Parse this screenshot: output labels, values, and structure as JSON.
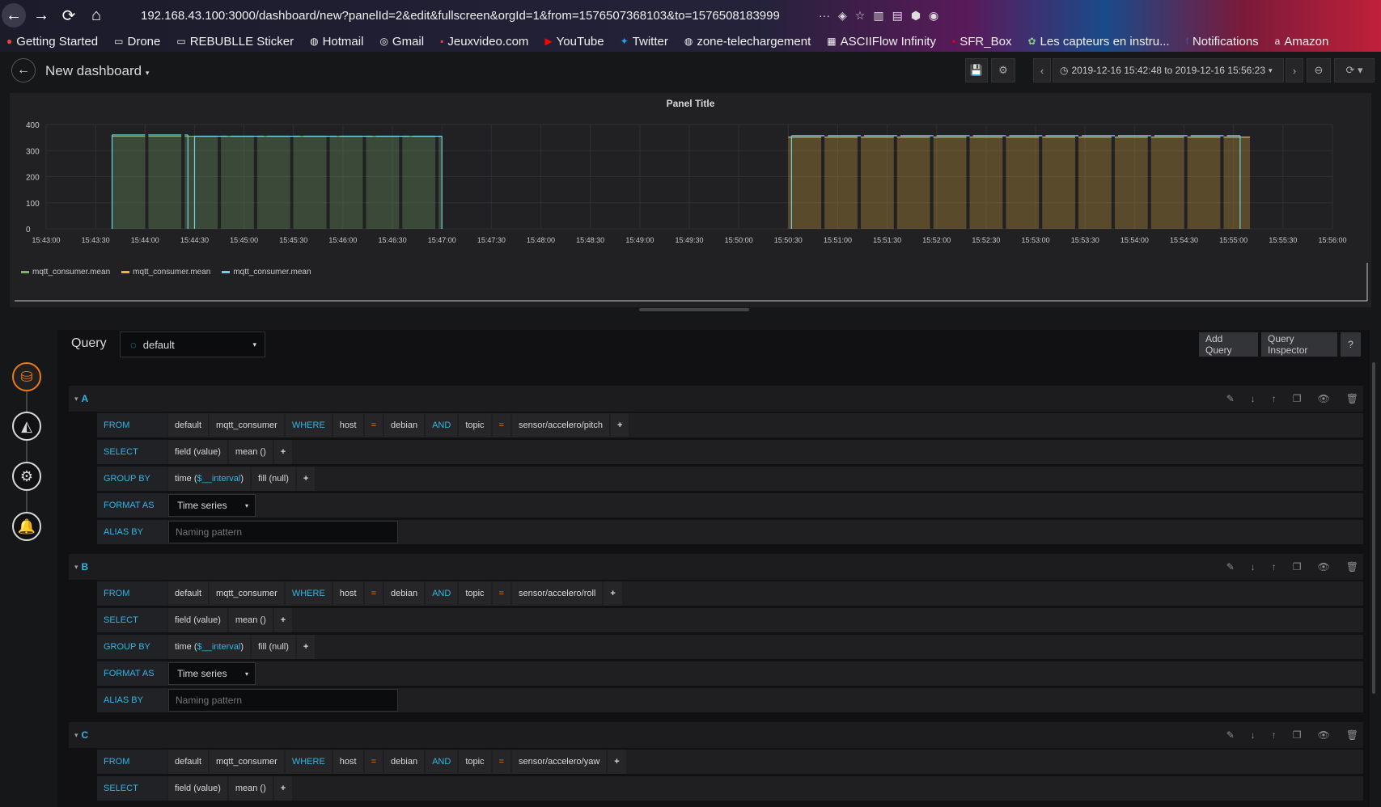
{
  "browser": {
    "url": "192.168.43.100:3000/dashboard/new?panelId=2&edit&fullscreen&orgId=1&from=1576507368103&to=1576508183999",
    "bookmarks": [
      "Getting Started",
      "Drone",
      "REBUBLLE Sticker",
      "Hotmail",
      "Gmail",
      "Jeuxvideo.com",
      "YouTube",
      "Twitter",
      "zone-telechargement",
      "ASCIIFlow Infinity",
      "SFR_Box",
      "Les capteurs en instru...",
      "Notifications",
      "Amazon"
    ]
  },
  "header": {
    "title": "New dashboard",
    "time_range": "2019-12-16 15:42:48 to 2019-12-16 15:56:23"
  },
  "panel": {
    "title": "Panel Title",
    "legend": [
      {
        "name": "mqtt_consumer.mean",
        "color": "#7eb26d"
      },
      {
        "name": "mqtt_consumer.mean",
        "color": "#eab839"
      },
      {
        "name": "mqtt_consumer.mean",
        "color": "#6ed0e0"
      }
    ]
  },
  "chart_data": {
    "type": "bar",
    "y_ticks": [
      "400",
      "300",
      "200",
      "100",
      "0"
    ],
    "ylim": [
      0,
      400
    ],
    "x_ticks": [
      "15:43:00",
      "15:43:30",
      "15:44:00",
      "15:44:30",
      "15:45:00",
      "15:45:30",
      "15:46:00",
      "15:46:30",
      "15:47:00",
      "15:47:30",
      "15:48:00",
      "15:48:30",
      "15:49:00",
      "15:49:30",
      "15:50:00",
      "15:50:30",
      "15:51:00",
      "15:51:30",
      "15:52:00",
      "15:52:30",
      "15:53:00",
      "15:53:30",
      "15:54:00",
      "15:54:30",
      "15:55:00",
      "15:55:30",
      "15:56:00"
    ],
    "series": [
      {
        "name": "mqtt_consumer.mean",
        "color": "#7eb26d",
        "segments": [
          [
            "15:43:40",
            "15:47:00",
            355
          ]
        ]
      },
      {
        "name": "mqtt_consumer.mean",
        "color": "#eab839",
        "segments": [
          [
            "15:50:30",
            "15:55:10",
            352
          ]
        ]
      },
      {
        "name": "mqtt_consumer.mean",
        "color": "#6ed0e0",
        "segments": [
          [
            "15:43:40",
            "15:44:26",
            360
          ],
          [
            "15:44:30",
            "15:47:00",
            355
          ],
          [
            "15:50:32",
            "15:55:04",
            357
          ]
        ]
      }
    ]
  },
  "editor": {
    "query_label": "Query",
    "datasource": "default",
    "add_query": "Add Query",
    "query_inspector": "Query Inspector",
    "help": "?",
    "queries": [
      {
        "ref": "A",
        "from": [
          "default",
          "mqtt_consumer"
        ],
        "where": [
          "host",
          "=",
          "debian",
          "AND",
          "topic",
          "=",
          "sensor/accelero/pitch"
        ],
        "select": [
          "field (value)",
          "mean ()"
        ],
        "group_by": [
          "time ($__interval)",
          "fill (null)"
        ],
        "format": "Time series",
        "alias_placeholder": "Naming pattern"
      },
      {
        "ref": "B",
        "from": [
          "default",
          "mqtt_consumer"
        ],
        "where": [
          "host",
          "=",
          "debian",
          "AND",
          "topic",
          "=",
          "sensor/accelero/roll"
        ],
        "select": [
          "field (value)",
          "mean ()"
        ],
        "group_by": [
          "time ($__interval)",
          "fill (null)"
        ],
        "format": "Time series",
        "alias_placeholder": "Naming pattern"
      },
      {
        "ref": "C",
        "from": [
          "default",
          "mqtt_consumer"
        ],
        "where": [
          "host",
          "=",
          "debian",
          "AND",
          "topic",
          "=",
          "sensor/accelero/yaw"
        ],
        "select": [
          "field (value)",
          "mean ()"
        ]
      }
    ],
    "labels": {
      "from": "FROM",
      "where": "WHERE",
      "select": "SELECT",
      "group_by": "GROUP BY",
      "format_as": "FORMAT AS",
      "alias_by": "ALIAS BY"
    }
  }
}
